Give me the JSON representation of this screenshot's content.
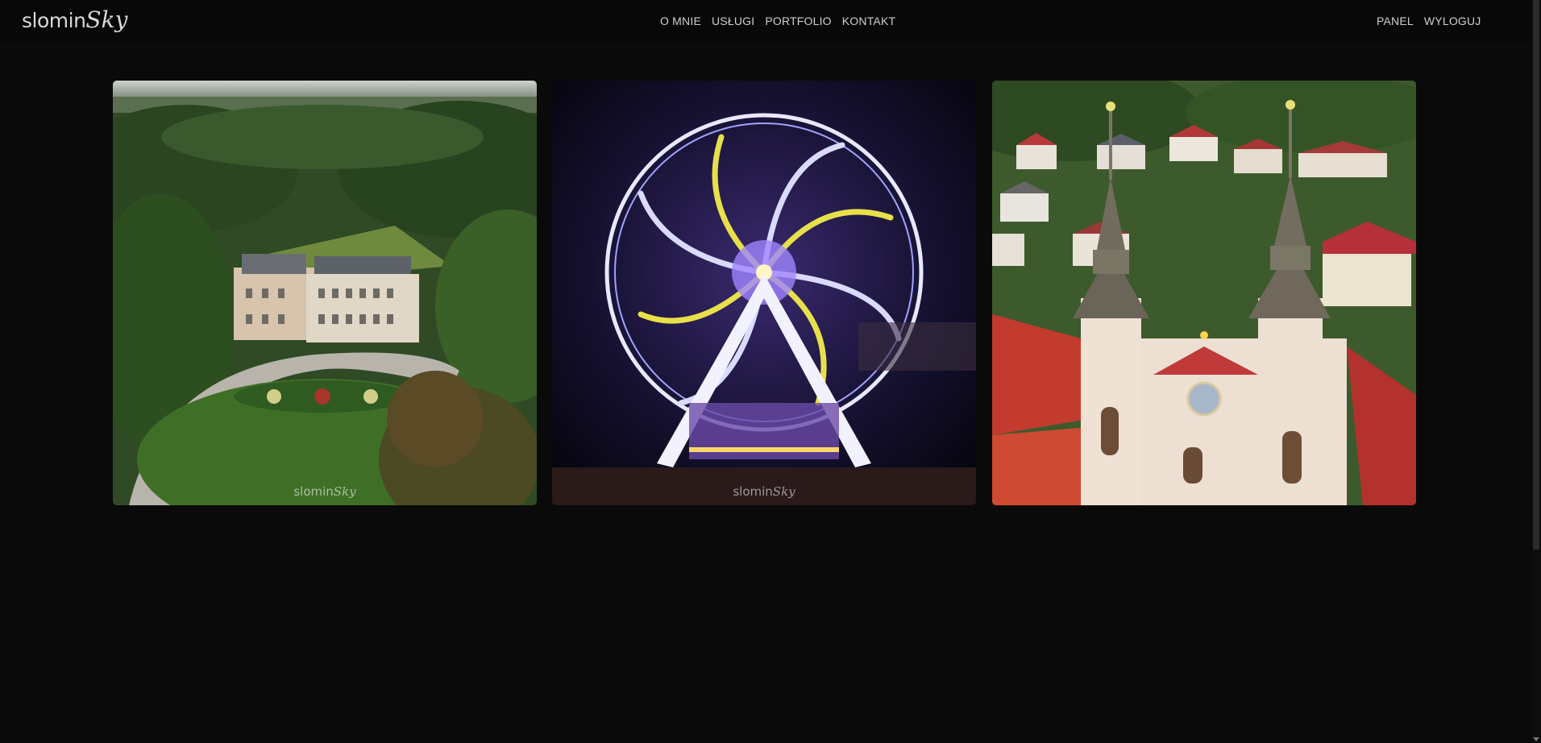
{
  "brand": {
    "part1": "slomin",
    "part2": "Sky"
  },
  "nav": {
    "items": [
      {
        "label": "O MNIE"
      },
      {
        "label": "USŁUGI"
      },
      {
        "label": "PORTFOLIO"
      },
      {
        "label": "KONTAKT"
      }
    ]
  },
  "user_nav": {
    "panel": "PANEL",
    "logout": "WYLOGUJ"
  },
  "gallery": {
    "photos": [
      {
        "subject": "palace-park-aerial",
        "watermark_a": "slomin",
        "watermark_b": "Sky"
      },
      {
        "subject": "ferris-wheel-night",
        "watermark_a": "slomin",
        "watermark_b": "Sky"
      },
      {
        "subject": "church-towers-aerial",
        "watermark_a": "",
        "watermark_b": ""
      }
    ]
  },
  "colors": {
    "background": "#0a0a0a",
    "nav_text": "#cfcfcf"
  }
}
